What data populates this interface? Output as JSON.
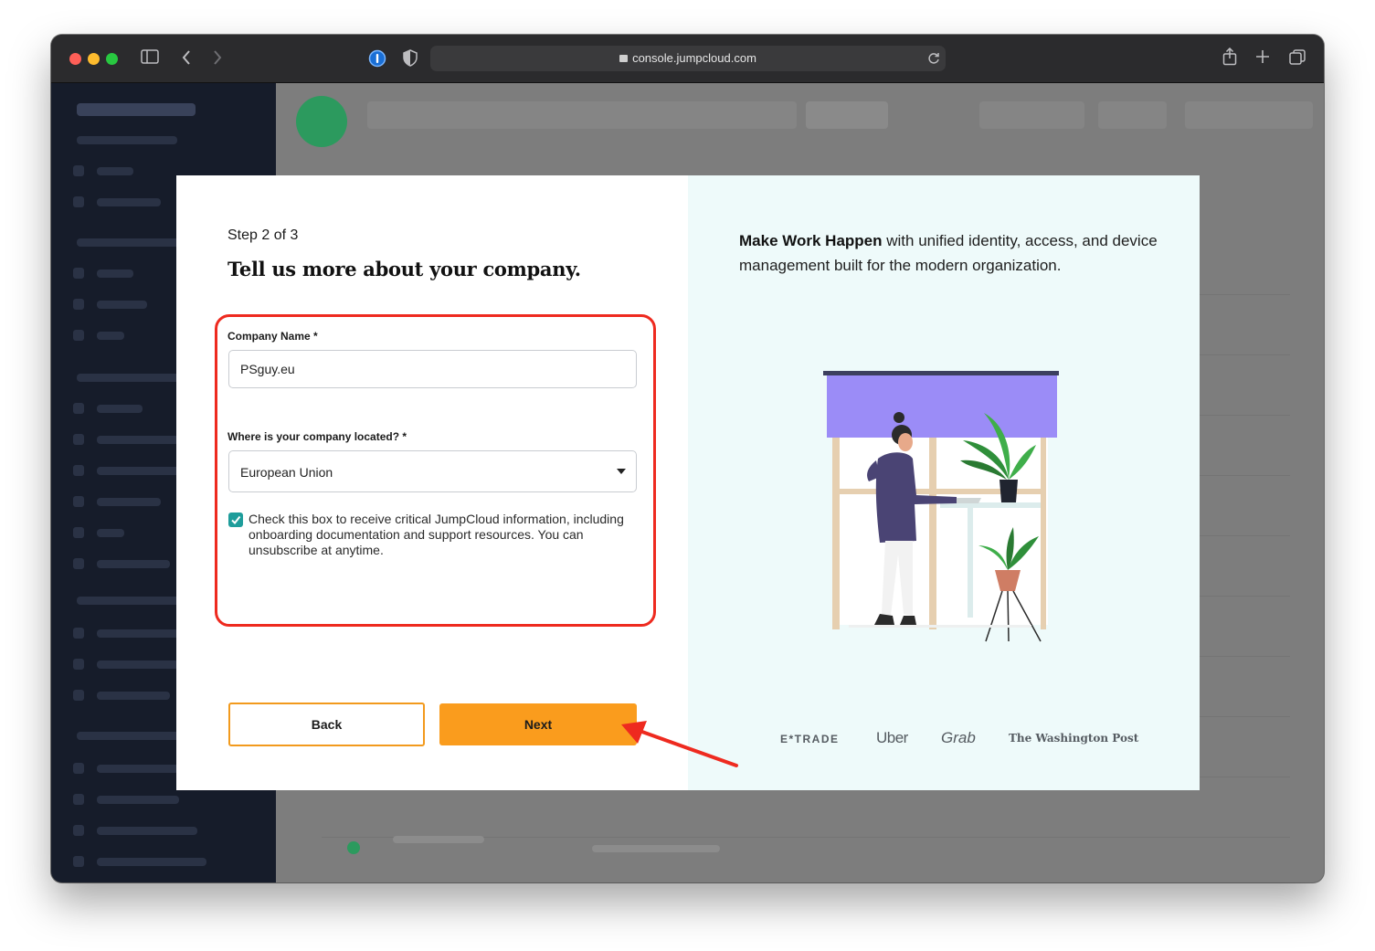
{
  "browser": {
    "url": "console.jumpcloud.com",
    "colors": {
      "close": "#fe5f57",
      "minimize": "#febc2e",
      "zoom": "#28c840"
    }
  },
  "modal": {
    "step": "Step 2 of 3",
    "heading": "Tell us more about your company.",
    "company_name": {
      "label": "Company Name *",
      "value": "PSguy.eu"
    },
    "location": {
      "label": "Where is your company located? *",
      "selected": "European Union"
    },
    "consent": {
      "checked": true,
      "text": "Check this box to receive critical JumpCloud information, including onboarding documentation and support resources. You can unsubscribe at anytime."
    },
    "back_label": "Back",
    "next_label": "Next",
    "accent_color": "#fa9c1d",
    "highlight_color": "#ee2a1f"
  },
  "promo": {
    "tagline_bold": "Make Work Happen",
    "tagline_rest": " with unified identity, access, and device management built for the modern organization.",
    "logos": [
      "E*TRADE",
      "Uber",
      "Grab",
      "The Washington Post"
    ]
  }
}
